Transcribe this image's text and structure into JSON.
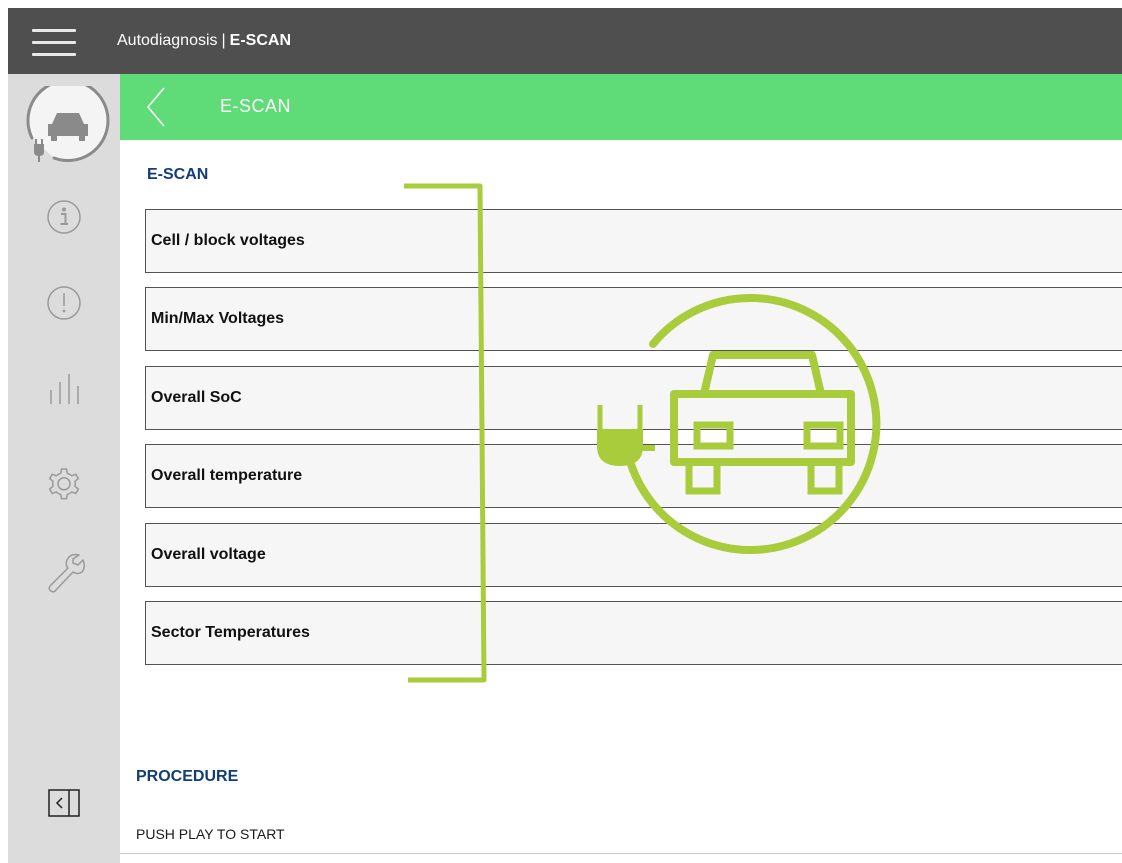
{
  "topbar": {
    "app_name": "Autodiagnosis",
    "separator": "|",
    "module": "E-SCAN",
    "menu_icon": "hamburger-menu-icon"
  },
  "sidebar": {
    "items": [
      {
        "name": "ev-car-plug-icon"
      },
      {
        "name": "info-icon"
      },
      {
        "name": "warning-icon"
      },
      {
        "name": "bar-chart-icon"
      },
      {
        "name": "gear-icon"
      },
      {
        "name": "wrench-icon"
      }
    ],
    "collapse_icon": "collapse-panel-icon"
  },
  "header": {
    "title": "E-SCAN",
    "back_icon": "chevron-left-icon",
    "color": "#5fdc78"
  },
  "main": {
    "section_title": "E-SCAN",
    "items": [
      {
        "label": "Cell / block voltages"
      },
      {
        "label": "Min/Max Voltages"
      },
      {
        "label": "Overall SoC"
      },
      {
        "label": "Overall temperature"
      },
      {
        "label": "Overall voltage"
      },
      {
        "label": "Sector Temperatures"
      }
    ],
    "overlay_icon": "ev-car-plug-icon",
    "overlay_color": "#a8cc3c"
  },
  "procedure": {
    "title": "PROCEDURE",
    "text": "PUSH PLAY TO START"
  },
  "colors": {
    "topbar": "#4f4f4f",
    "sidebar": "#dcdcdc",
    "section_title": "#133d78"
  }
}
